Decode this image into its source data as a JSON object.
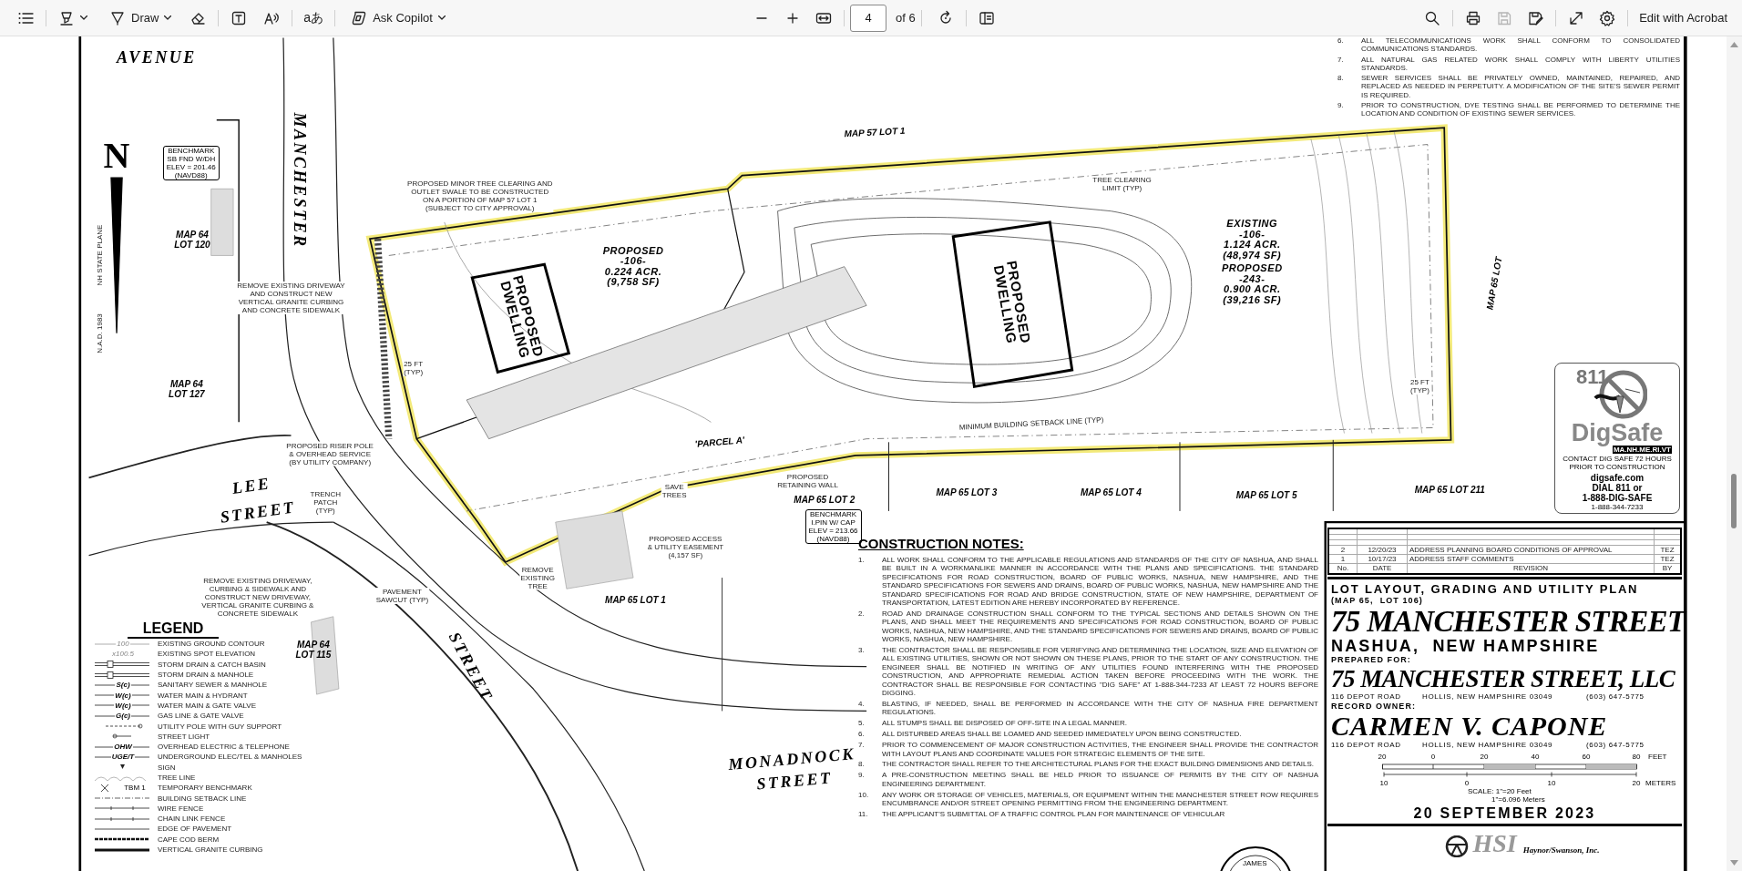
{
  "toolbar": {
    "draw_label": "Draw",
    "translate_glyph": "aあ",
    "copilot_label": "Ask Copilot",
    "page_number": "4",
    "page_count": "of 6",
    "save_disabled": true,
    "edit_label": "Edit with Acrobat"
  },
  "map_labels": [
    {
      "kind": "street",
      "lines": [
        "AVENUE"
      ]
    },
    {
      "kind": "street",
      "lines": [
        "MANCHESTER"
      ]
    },
    {
      "kind": "north",
      "lines": [
        "N"
      ]
    },
    {
      "kind": "benchmark",
      "lines": [
        "BENCHMARK",
        "SB FND W/DH",
        "ELEV = 201.46",
        "(NAVD88)"
      ]
    },
    {
      "kind": "note",
      "lines": [
        "NH STATE PLANE"
      ]
    },
    {
      "kind": "note",
      "lines": [
        "N.A.D. 1983"
      ]
    },
    {
      "kind": "lot",
      "lines": [
        "MAP 64",
        "LOT 120"
      ]
    },
    {
      "kind": "lot",
      "lines": [
        "MAP 64",
        "LOT 127"
      ]
    },
    {
      "kind": "street",
      "lines": [
        "LEE"
      ]
    },
    {
      "kind": "street",
      "lines": [
        "STREET"
      ]
    },
    {
      "kind": "lot",
      "lines": [
        "MAP 64",
        "LOT 115"
      ]
    },
    {
      "kind": "street",
      "lines": [
        "STREET"
      ]
    },
    {
      "kind": "street",
      "lines": [
        "MONADNOCK"
      ]
    },
    {
      "kind": "street",
      "lines": [
        "STREET"
      ]
    },
    {
      "kind": "lot",
      "lines": [
        "MAP 57  LOT 1"
      ]
    },
    {
      "kind": "area",
      "lines": [
        "PROPOSED",
        "-106-",
        "0.224 ACR.",
        "(9,758 SF)"
      ]
    },
    {
      "kind": "dwelling",
      "lines": [
        "PROPOSED",
        "DWELLING"
      ]
    },
    {
      "kind": "dwelling",
      "lines": [
        "PROPOSED",
        "DWELLING"
      ]
    },
    {
      "kind": "area",
      "lines": [
        "EXISTING",
        "-106-",
        "1.124 ACR.",
        "(48,974 SF)"
      ]
    },
    {
      "kind": "area",
      "lines": [
        "PROPOSED",
        "-243-",
        "0.900 ACR.",
        "(39,216 SF)"
      ]
    },
    {
      "kind": "lot",
      "lines": [
        "MAP 65  LOT"
      ]
    },
    {
      "kind": "lot",
      "lines": [
        "MAP 65  LOT 3"
      ]
    },
    {
      "kind": "lot",
      "lines": [
        "MAP 65  LOT 4"
      ]
    },
    {
      "kind": "lot",
      "lines": [
        "MAP 65  LOT 5"
      ]
    },
    {
      "kind": "lot",
      "lines": [
        "MAP 65  LOT 211"
      ]
    },
    {
      "kind": "lot",
      "lines": [
        "MAP 65  LOT 2"
      ]
    },
    {
      "kind": "lot",
      "lines": [
        "MAP 65  LOT 1"
      ]
    },
    {
      "kind": "lot",
      "lines": [
        "'PARCEL  A'"
      ]
    },
    {
      "kind": "benchmark",
      "lines": [
        "BENCHMARK",
        "I.PIN W/ CAP",
        "ELEV = 213.66",
        "(NAVD88)"
      ]
    },
    {
      "kind": "note",
      "lines": [
        "PROPOSED ACCESS",
        "& UTILITY EASEMENT",
        "(4,157 SF)"
      ]
    },
    {
      "kind": "note",
      "lines": [
        "PROPOSED MINOR TREE CLEARING AND",
        "OUTLET SWALE TO BE CONSTRUCTED",
        "ON A PORTION OF MAP 57 LOT 1",
        "(SUBJECT TO CITY APPROVAL)"
      ]
    },
    {
      "kind": "note",
      "lines": [
        "REMOVE EXISTING DRIVEWAY",
        "AND CONSTRUCT NEW",
        "VERTICAL GRANITE CURBING",
        "AND CONCRETE SIDEWALK"
      ]
    },
    {
      "kind": "note",
      "lines": [
        "PROPOSED RISER POLE",
        "& OVERHEAD SERVICE",
        "(BY UTILITY COMPANY)"
      ]
    },
    {
      "kind": "note",
      "lines": [
        "TRENCH",
        "PATCH",
        "(TYP)"
      ]
    },
    {
      "kind": "note",
      "lines": [
        "SAVE",
        "TREES"
      ]
    },
    {
      "kind": "note",
      "lines": [
        "PROPOSED",
        "RETAINING WALL"
      ]
    },
    {
      "kind": "note",
      "lines": [
        "REMOVE",
        "EXISTING",
        "TREE"
      ]
    },
    {
      "kind": "note",
      "lines": [
        "REMOVE EXISTING DRIVEWAY,",
        "CURBING & SIDEWALK AND",
        "CONSTRUCT NEW DRIVEWAY,",
        "VERTICAL GRANITE CURBING &",
        "CONCRETE SIDEWALK"
      ]
    },
    {
      "kind": "note",
      "lines": [
        "PAVEMENT",
        "SAWCUT (TYP)"
      ]
    },
    {
      "kind": "note",
      "lines": [
        "TREE CLEARING",
        "LIMIT (TYP)"
      ]
    },
    {
      "kind": "note",
      "lines": [
        "MINIMUM BUILDING SETBACK LINE (TYP)"
      ]
    },
    {
      "kind": "note",
      "lines": [
        "25 FT",
        "(TYP)"
      ]
    },
    {
      "kind": "note",
      "lines": [
        "25 FT",
        "(TYP)"
      ]
    }
  ],
  "general_notes": [
    {
      "number": "6.",
      "text": "ALL TELECOMMUNICATIONS WORK SHALL CONFORM TO CONSOLIDATED COMMUNICATIONS STANDARDS."
    },
    {
      "number": "7.",
      "text": "ALL NATURAL GAS RELATED WORK SHALL COMPLY WITH LIBERTY UTILITIES STANDARDS."
    },
    {
      "number": "8.",
      "text": "SEWER SERVICES SHALL BE PRIVATELY OWNED, MAINTAINED, REPAIRED, AND REPLACED AS NEEDED IN PERPETUITY. A MODIFICATION OF THE SITE'S SEWER PERMIT IS REQUIRED."
    },
    {
      "number": "9.",
      "text": "PRIOR TO CONSTRUCTION, DYE TESTING SHALL BE PERFORMED TO DETERMINE THE LOCATION AND CONDITION OF EXISTING SEWER SERVICES."
    }
  ],
  "construction_notes": {
    "title": "CONSTRUCTION NOTES:",
    "items": [
      {
        "number": "1.",
        "text": "ALL WORK SHALL CONFORM TO THE APPLICABLE REGULATIONS AND STANDARDS OF THE CITY OF NASHUA, AND SHALL BE BUILT IN A WORKMANLIKE MANNER IN ACCORDANCE WITH THE PLANS AND SPECIFICATIONS.  THE STANDARD SPECIFICATIONS FOR ROAD CONSTRUCTION, BOARD OF PUBLIC WORKS, NASHUA, NEW HAMPSHIRE, AND THE STANDARD SPECIFICATIONS FOR SEWERS AND DRAINS, BOARD OF PUBLIC WORKS, NASHUA, NEW HAMPSHIRE AND THE STANDARD SPECIFICATIONS FOR ROAD AND BRIDGE CONSTRUCTION, STATE OF NEW HAMPSHIRE, DEPARTMENT OF TRANSPORTATION, LATEST EDITION ARE HEREBY INCORPORATED BY REFERENCE."
      },
      {
        "number": "2.",
        "text": "ROAD AND DRAINAGE CONSTRUCTION SHALL CONFORM TO THE TYPICAL SECTIONS AND DETAILS SHOWN ON THE PLANS, AND SHALL MEET THE REQUIREMENTS AND SPECIFICATIONS FOR ROAD CONSTRUCTION, BOARD OF PUBLIC WORKS, NASHUA, NEW HAMPSHIRE, AND THE STANDARD SPECIFICATIONS FOR SEWERS AND DRAINS, BOARD OF PUBLIC WORKS, NASHUA, NEW HAMPSHIRE."
      },
      {
        "number": "3.",
        "text": "THE CONTRACTOR SHALL BE RESPONSIBLE FOR VERIFYING AND DETERMINING THE LOCATION, SIZE AND ELEVATION OF ALL EXISTING UTILITIES, SHOWN OR NOT SHOWN ON THESE PLANS, PRIOR TO THE START OF ANY CONSTRUCTION.  THE ENGINEER SHALL BE NOTIFIED IN WRITING OF ANY UTILITIES FOUND INTERFERING WITH THE PROPOSED CONSTRUCTION, AND APPROPRIATE REMEDIAL ACTION TAKEN BEFORE PROCEEDING WITH THE WORK.  THE CONTRACTOR SHALL BE RESPONSIBLE FOR CONTACTING \"DIG SAFE\" AT 1-888-344-7233 AT LEAST 72 HOURS BEFORE DIGGING."
      },
      {
        "number": "4.",
        "text": "BLASTING, IF NEEDED, SHALL BE PERFORMED IN ACCORDANCE WITH THE CITY OF NASHUA FIRE DEPARTMENT REGULATIONS."
      },
      {
        "number": "5.",
        "text": "ALL STUMPS SHALL BE DISPOSED OF OFF-SITE IN A LEGAL MANNER."
      },
      {
        "number": "6.",
        "text": "ALL DISTURBED AREAS SHALL BE LOAMED AND SEEDED IMMEDIATELY UPON BEING CONSTRUCTED."
      },
      {
        "number": "7.",
        "text": "PRIOR TO COMMENCEMENT OF MAJOR CONSTRUCTION ACTIVITIES, THE ENGINEER SHALL PROVIDE THE CONTRACTOR WITH LAYOUT PLANS AND COORDINATE VALUES FOR STRATEGIC ELEMENTS OF THE SITE."
      },
      {
        "number": "8.",
        "text": "THE CONTRACTOR SHALL REFER TO THE ARCHITECTURAL PLANS FOR THE EXACT BUILDING DIMENSIONS AND DETAILS."
      },
      {
        "number": "9.",
        "text": "A PRE-CONSTRUCTION MEETING SHALL BE HELD PRIOR TO ISSUANCE OF PERMITS BY THE CITY OF NASHUA ENGINEERING DEPARTMENT."
      },
      {
        "number": "10.",
        "text": "ANY WORK OR STORAGE OF VEHICLES, MATERIALS, OR EQUIPMENT WITHIN THE MANCHESTER STREET ROW REQUIRES ENCUMBRANCE AND/OR STREET OPENING PERMITTING FROM THE ENGINEERING DEPARTMENT."
      },
      {
        "number": "11.",
        "text": "THE APPLICANT'S SUBMITTAL OF A TRAFFIC CONTROL PLAN FOR MAINTENANCE OF VEHICULAR"
      }
    ]
  },
  "legend": {
    "title": "LEGEND",
    "items": [
      {
        "kind": "contour",
        "symbol_text": "100",
        "label": "EXISTING GROUND CONTOUR"
      },
      {
        "kind": "spot",
        "symbol_text": "x100.5",
        "label": "EXISTING SPOT ELEVATION"
      },
      {
        "kind": "double",
        "label": "STORM DRAIN & CATCH BASIN"
      },
      {
        "kind": "double",
        "label": "STORM DRAIN & MANHOLE"
      },
      {
        "kind": "line",
        "symbol_text": "S(c)",
        "label": "SANITARY SEWER & MANHOLE"
      },
      {
        "kind": "line",
        "symbol_text": "W(c)",
        "label": "WATER MAIN & HYDRANT"
      },
      {
        "kind": "line",
        "symbol_text": "W(c)",
        "label": "WATER MAIN & GATE VALVE"
      },
      {
        "kind": "line",
        "symbol_text": "G(c)",
        "label": "GAS LINE & GATE VALVE"
      },
      {
        "kind": "dashed",
        "label": "UTILITY POLE WITH GUY SUPPORT"
      },
      {
        "kind": "short",
        "label": "STREET LIGHT"
      },
      {
        "kind": "line",
        "symbol_text": "OHW",
        "label": "OVERHEAD ELECTRIC & TELEPHONE"
      },
      {
        "kind": "line",
        "symbol_text": "UGE/T",
        "label": "UNDERGROUND ELEC/TEL & MANHOLES"
      },
      {
        "kind": "sign",
        "label": "SIGN"
      },
      {
        "kind": "tree",
        "label": "TREE LINE"
      },
      {
        "kind": "benchmark",
        "symbol_text": "TBM 1",
        "label": "TEMPORARY BENCHMARK"
      },
      {
        "kind": "dashdot",
        "label": "BUILDING SETBACK LINE"
      },
      {
        "kind": "fence",
        "label": "WIRE FENCE"
      },
      {
        "kind": "fence",
        "label": "CHAIN LINK FENCE"
      },
      {
        "kind": "line",
        "label": "EDGE OF PAVEMENT"
      },
      {
        "kind": "berm",
        "label": "CAPE COD BERM"
      },
      {
        "kind": "curb",
        "label": "VERTICAL GRANITE CURBING"
      }
    ]
  },
  "dig_safe": {
    "number": "811",
    "brand": "DigSafe",
    "states": "MA.NH.ME.RI.VT",
    "notice": [
      "CONTACT DIG SAFE 72 HOURS",
      "PRIOR TO CONSTRUCTION"
    ],
    "website": "digsafe.com",
    "dial": "DIAL 811 or",
    "phone": "1-888-DIG-SAFE",
    "phone_digits": "1-888-344-7233"
  },
  "revisions": {
    "columns": [
      "No.",
      "DATE",
      "REVISION",
      "BY"
    ],
    "rows": [
      {
        "no": "2",
        "date": "12/20/23",
        "revision": "ADDRESS PLANNING BOARD CONDITIONS OF APPROVAL",
        "by": "TEZ"
      },
      {
        "no": "1",
        "date": "10/17/23",
        "revision": "ADDRESS STAFF COMMENTS",
        "by": "TEZ"
      }
    ]
  },
  "title_block": {
    "plan_title": "LOT LAYOUT, GRADING AND UTILITY PLAN",
    "map_lot": "(MAP 65,  LOT 106)",
    "site": "75 MANCHESTER STREET",
    "city": "NASHUA,  NEW HAMPSHIRE",
    "prepared_for_label": "PREPARED FOR:",
    "client": "75 MANCHESTER STREET, LLC",
    "client_address": [
      "116 DEPOT ROAD",
      "HOLLIS, NEW HAMPSHIRE 03049",
      "(603) 647-5775"
    ],
    "owner_label": "RECORD OWNER:",
    "owner": "CARMEN V. CAPONE",
    "owner_address": [
      "116 DEPOT ROAD",
      "HOLLIS, NEW HAMPSHIRE 03049",
      "(603) 647-5775"
    ],
    "date": "20 SEPTEMBER 2023"
  },
  "scale_bar": {
    "feet_ticks": [
      "20",
      "0",
      "20",
      "40",
      "60",
      "80"
    ],
    "feet_unit": "FEET",
    "meter_ticks": [
      "10",
      "0",
      "10",
      "20"
    ],
    "meter_unit": "METERS",
    "scale": "SCALE: 1\"=20 Feet",
    "metric": "1\"=6.096 Meters"
  },
  "firm": {
    "initials": "HSI",
    "name": "Haynor/Swanson, Inc."
  },
  "seal": {
    "text": "JAMES"
  }
}
